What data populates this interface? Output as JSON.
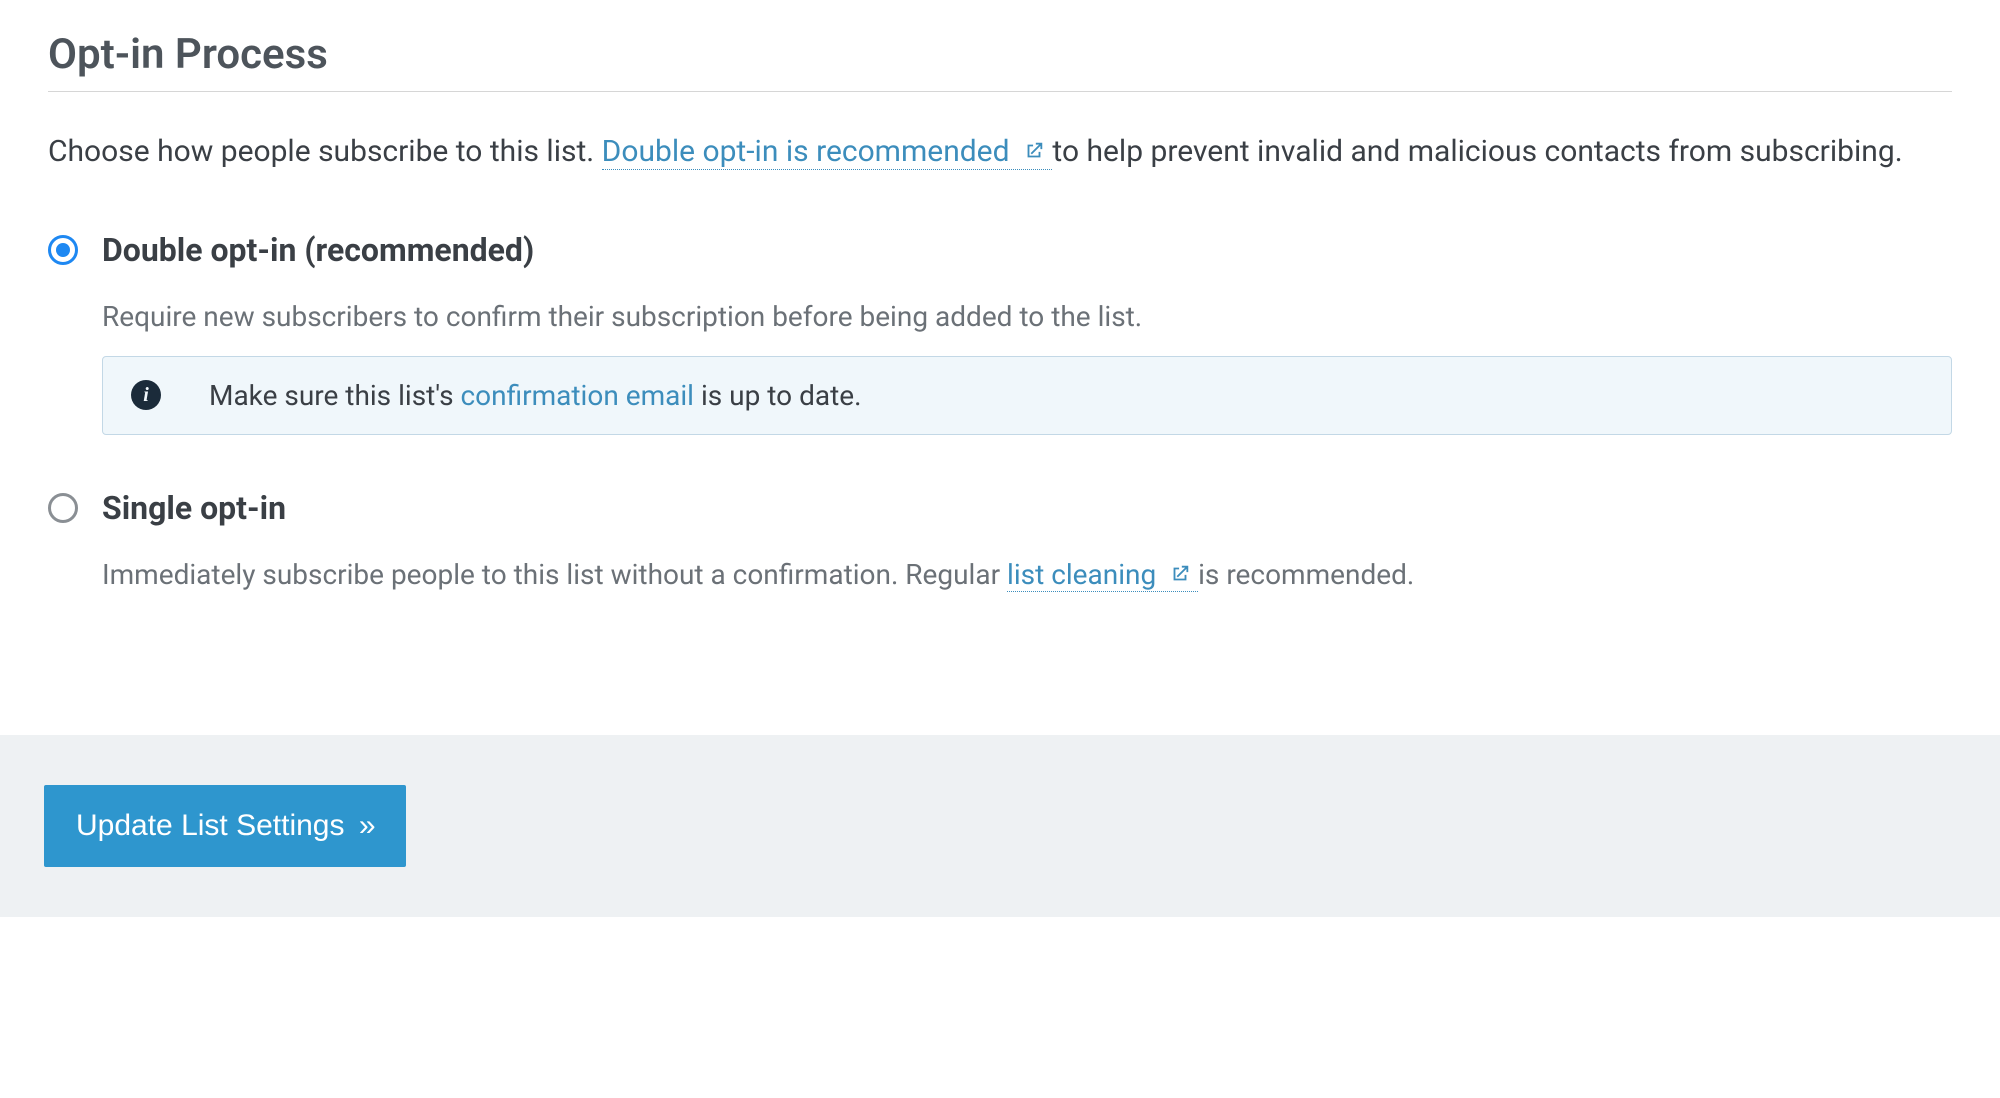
{
  "section": {
    "title": "Opt-in Process",
    "intro_before": "Choose how people subscribe to this list. ",
    "intro_link": "Double opt-in is recommended",
    "intro_after": " to help prevent invalid and malicious contacts from subscribing."
  },
  "options": {
    "double": {
      "label": "Double opt-in (recommended)",
      "desc": "Require new subscribers to confirm their subscription before being added to the list.",
      "info_before": "Make sure this list's ",
      "info_link": "confirmation email",
      "info_after": " is up to date."
    },
    "single": {
      "label": "Single opt-in",
      "desc_before": "Immediately subscribe people to this list without a confirmation. Regular ",
      "desc_link": "list cleaning",
      "desc_after": " is recommended."
    }
  },
  "footer": {
    "button": "Update List Settings"
  }
}
